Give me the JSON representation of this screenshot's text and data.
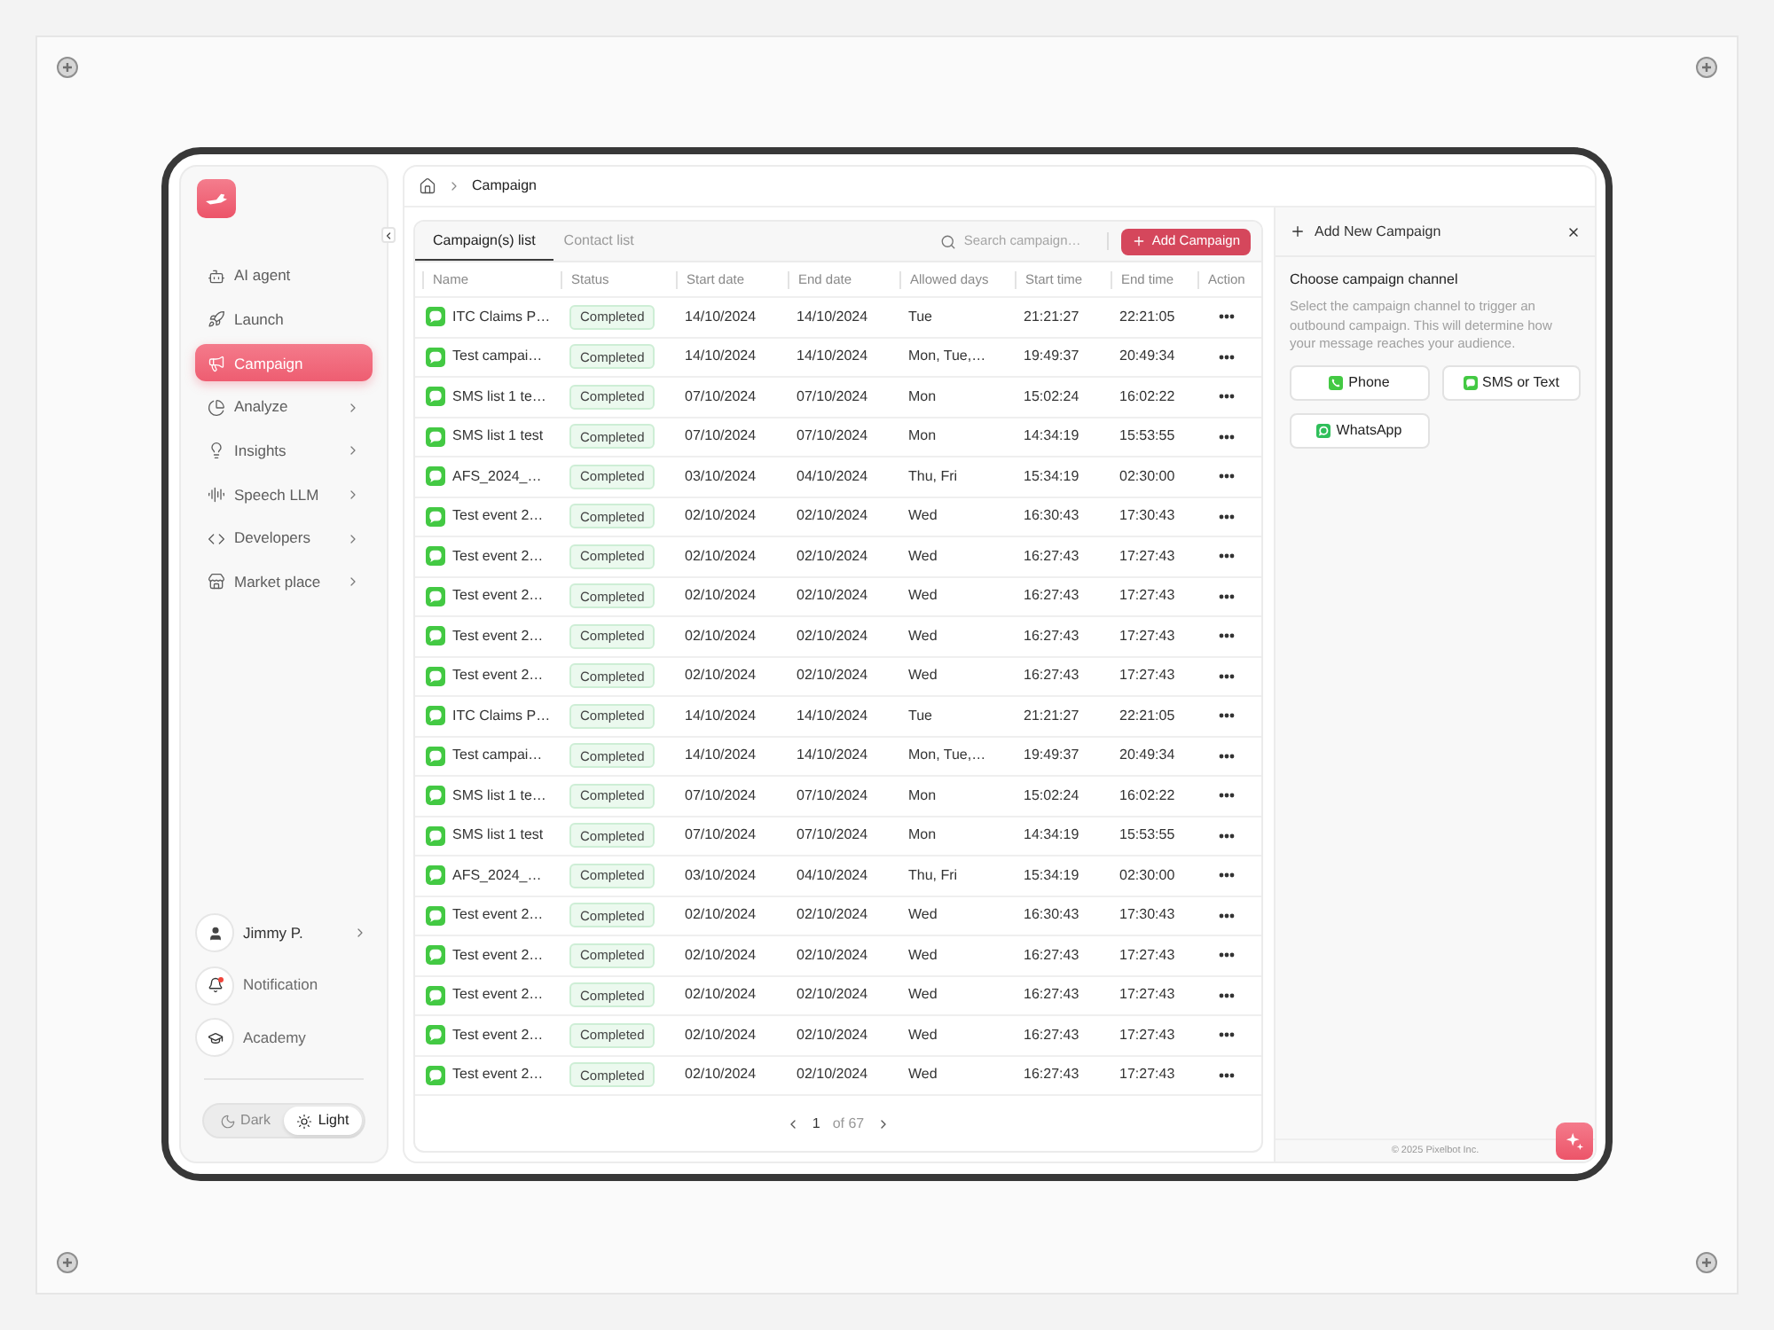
{
  "breadcrumb": {
    "current": "Campaign"
  },
  "sidebar": {
    "nav": [
      {
        "label": "AI agent",
        "selected": false,
        "expandable": false
      },
      {
        "label": "Launch",
        "selected": false,
        "expandable": false
      },
      {
        "label": "Campaign",
        "selected": true,
        "expandable": false
      },
      {
        "label": "Analyze",
        "selected": false,
        "expandable": true
      },
      {
        "label": "Insights",
        "selected": false,
        "expandable": true
      },
      {
        "label": "Speech LLM",
        "selected": false,
        "expandable": true
      },
      {
        "label": "Developers",
        "selected": false,
        "expandable": true
      },
      {
        "label": "Market place",
        "selected": false,
        "expandable": true
      }
    ],
    "account": {
      "name": "Jimmy P."
    },
    "links": [
      {
        "label": "Notification",
        "alert": true
      },
      {
        "label": "Academy",
        "alert": false
      }
    ],
    "theme": [
      {
        "label": "Dark",
        "selected": false
      },
      {
        "label": "Light",
        "selected": true
      }
    ]
  },
  "campaigns": {
    "tabs": [
      {
        "label": "Campaign(s) list",
        "selected": true
      },
      {
        "label": "Contact list",
        "selected": false
      }
    ],
    "search": {
      "placeholder": "Search campaign…"
    },
    "add_button": "Add Campaign",
    "columns": [
      "Name",
      "Status",
      "Start date",
      "End date",
      "Allowed days",
      "Start time",
      "End time",
      "Action"
    ],
    "rows": [
      {
        "name": "ITC Claims P…",
        "status": "Completed",
        "start_date": "14/10/2024",
        "end_date": "14/10/2024",
        "allowed_days": "Tue",
        "start_time": "21:21:27",
        "end_time": "22:21:05"
      },
      {
        "name": "Test campai…",
        "status": "Completed",
        "start_date": "14/10/2024",
        "end_date": "14/10/2024",
        "allowed_days": "Mon, Tue,…",
        "start_time": "19:49:37",
        "end_time": "20:49:34"
      },
      {
        "name": "SMS list 1 te…",
        "status": "Completed",
        "start_date": "07/10/2024",
        "end_date": "07/10/2024",
        "allowed_days": "Mon",
        "start_time": "15:02:24",
        "end_time": "16:02:22"
      },
      {
        "name": "SMS list 1 test",
        "status": "Completed",
        "start_date": "07/10/2024",
        "end_date": "07/10/2024",
        "allowed_days": "Mon",
        "start_time": "14:34:19",
        "end_time": "15:53:55"
      },
      {
        "name": "AFS_2024_…",
        "status": "Completed",
        "start_date": "03/10/2024",
        "end_date": "04/10/2024",
        "allowed_days": "Thu, Fri",
        "start_time": "15:34:19",
        "end_time": "02:30:00"
      },
      {
        "name": "Test event 2…",
        "status": "Completed",
        "start_date": "02/10/2024",
        "end_date": "02/10/2024",
        "allowed_days": "Wed",
        "start_time": "16:30:43",
        "end_time": "17:30:43"
      },
      {
        "name": "Test event 2…",
        "status": "Completed",
        "start_date": "02/10/2024",
        "end_date": "02/10/2024",
        "allowed_days": "Wed",
        "start_time": "16:27:43",
        "end_time": "17:27:43"
      },
      {
        "name": "Test event 2…",
        "status": "Completed",
        "start_date": "02/10/2024",
        "end_date": "02/10/2024",
        "allowed_days": "Wed",
        "start_time": "16:27:43",
        "end_time": "17:27:43"
      },
      {
        "name": "Test event 2…",
        "status": "Completed",
        "start_date": "02/10/2024",
        "end_date": "02/10/2024",
        "allowed_days": "Wed",
        "start_time": "16:27:43",
        "end_time": "17:27:43"
      },
      {
        "name": "Test event 2…",
        "status": "Completed",
        "start_date": "02/10/2024",
        "end_date": "02/10/2024",
        "allowed_days": "Wed",
        "start_time": "16:27:43",
        "end_time": "17:27:43"
      },
      {
        "name": "ITC Claims P…",
        "status": "Completed",
        "start_date": "14/10/2024",
        "end_date": "14/10/2024",
        "allowed_days": "Tue",
        "start_time": "21:21:27",
        "end_time": "22:21:05"
      },
      {
        "name": "Test campai…",
        "status": "Completed",
        "start_date": "14/10/2024",
        "end_date": "14/10/2024",
        "allowed_days": "Mon, Tue,…",
        "start_time": "19:49:37",
        "end_time": "20:49:34"
      },
      {
        "name": "SMS list 1 te…",
        "status": "Completed",
        "start_date": "07/10/2024",
        "end_date": "07/10/2024",
        "allowed_days": "Mon",
        "start_time": "15:02:24",
        "end_time": "16:02:22"
      },
      {
        "name": "SMS list 1 test",
        "status": "Completed",
        "start_date": "07/10/2024",
        "end_date": "07/10/2024",
        "allowed_days": "Mon",
        "start_time": "14:34:19",
        "end_time": "15:53:55"
      },
      {
        "name": "AFS_2024_…",
        "status": "Completed",
        "start_date": "03/10/2024",
        "end_date": "04/10/2024",
        "allowed_days": "Thu, Fri",
        "start_time": "15:34:19",
        "end_time": "02:30:00"
      },
      {
        "name": "Test event 2…",
        "status": "Completed",
        "start_date": "02/10/2024",
        "end_date": "02/10/2024",
        "allowed_days": "Wed",
        "start_time": "16:30:43",
        "end_time": "17:30:43"
      },
      {
        "name": "Test event 2…",
        "status": "Completed",
        "start_date": "02/10/2024",
        "end_date": "02/10/2024",
        "allowed_days": "Wed",
        "start_time": "16:27:43",
        "end_time": "17:27:43"
      },
      {
        "name": "Test event 2…",
        "status": "Completed",
        "start_date": "02/10/2024",
        "end_date": "02/10/2024",
        "allowed_days": "Wed",
        "start_time": "16:27:43",
        "end_time": "17:27:43"
      },
      {
        "name": "Test event 2…",
        "status": "Completed",
        "start_date": "02/10/2024",
        "end_date": "02/10/2024",
        "allowed_days": "Wed",
        "start_time": "16:27:43",
        "end_time": "17:27:43"
      },
      {
        "name": "Test event 2…",
        "status": "Completed",
        "start_date": "02/10/2024",
        "end_date": "02/10/2024",
        "allowed_days": "Wed",
        "start_time": "16:27:43",
        "end_time": "17:27:43"
      }
    ],
    "pagination": {
      "page": "1",
      "total": "of 67"
    }
  },
  "new_campaign_panel": {
    "title": "Add New Campaign",
    "heading": "Choose campaign channel",
    "description": "Select the campaign channel to trigger an outbound campaign. This will determine how your message reaches your audience.",
    "channels": [
      "Phone",
      "SMS or Text",
      "WhatsApp"
    ],
    "footer": "© 2025 Pixelbot Inc."
  }
}
